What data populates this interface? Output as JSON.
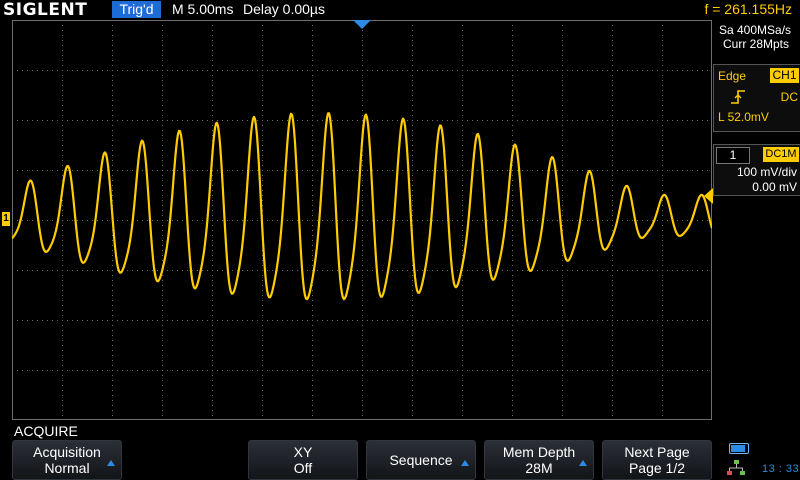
{
  "header": {
    "brand": "SIGLENT",
    "trigger_status": "Trig'd",
    "timebase": "M 5.00ms",
    "delay": "Delay 0.00µs",
    "frequency": "f = 261.155Hz"
  },
  "acquisition_info": {
    "sample_rate": "Sa 400MSa/s",
    "memory": "Curr 28Mpts"
  },
  "trigger_panel": {
    "type": "Edge",
    "source": "CH1",
    "slope_icon": "rising-edge-icon",
    "coupling": "DC",
    "level": "L  52.0mV"
  },
  "channel_panel": {
    "channel": "1",
    "coupling_impedance": "DC1M",
    "scale": "100 mV/div",
    "offset": "0.00 mV"
  },
  "markers": {
    "channel_marker": "1"
  },
  "menu": {
    "title": "ACQUIRE",
    "softkeys": [
      {
        "line1": "Acquisition",
        "line2": "Normal",
        "arrow": true
      },
      {
        "line1": "XY",
        "line2": "Off",
        "arrow": false
      },
      {
        "line1": "Sequence",
        "line2": "",
        "arrow": true
      },
      {
        "line1": "Mem Depth",
        "line2": "28M",
        "arrow": true
      },
      {
        "line1": "Next Page",
        "line2": "Page 1/2",
        "arrow": false
      }
    ]
  },
  "status": {
    "clock": "13 : 33"
  },
  "colors": {
    "trace": "#ffcc00",
    "accent": "#1f6bd6",
    "grid": "#6e6e6e"
  }
}
